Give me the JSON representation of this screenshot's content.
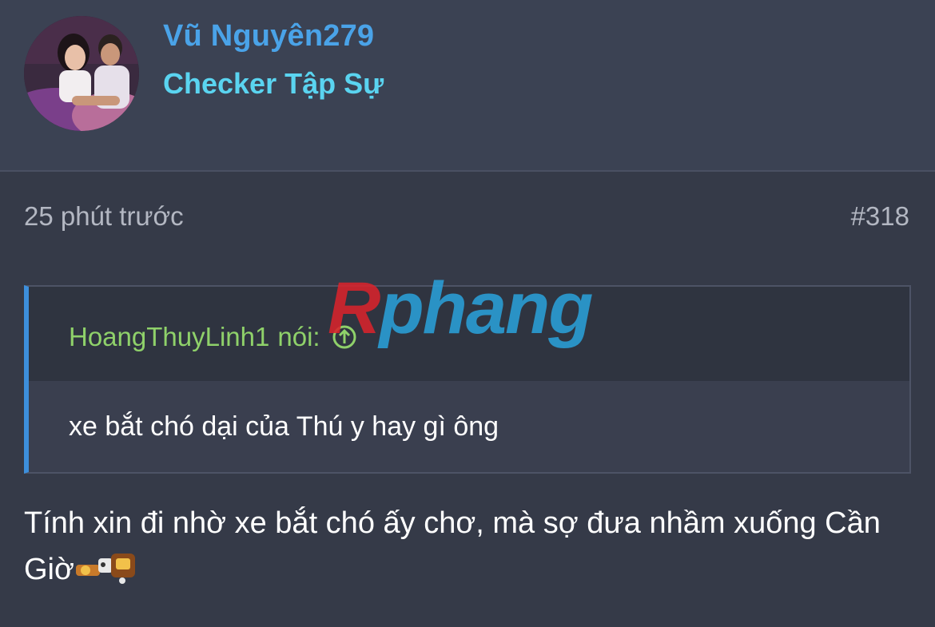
{
  "user": {
    "name": "Vũ Nguyên279",
    "title": "Checker Tập Sự",
    "avatar_icon": "avatar-photo"
  },
  "post": {
    "time": "25 phút trước",
    "number": "#318"
  },
  "quote": {
    "author": "HoangThuyLinh1",
    "said_label": "nói:",
    "jump_icon": "arrow-up-circle-icon",
    "text": "xe bắt chó dại của Thú y hay gì ông"
  },
  "reply": {
    "text": "Tính xin đi nhờ xe bắt chó ấy chơ, mà sợ đưa nhầm xuống Cần Giờ",
    "emoji_icon": "smiley-emoji-icon"
  },
  "watermark": {
    "first": "R",
    "rest": "phang"
  },
  "colors": {
    "background": "#353a48",
    "header_bg": "#3b4253",
    "username": "#4aa3e8",
    "user_title": "#5ad4f0",
    "quote_author": "#8fd16a",
    "quote_border": "#3d8fdc"
  }
}
